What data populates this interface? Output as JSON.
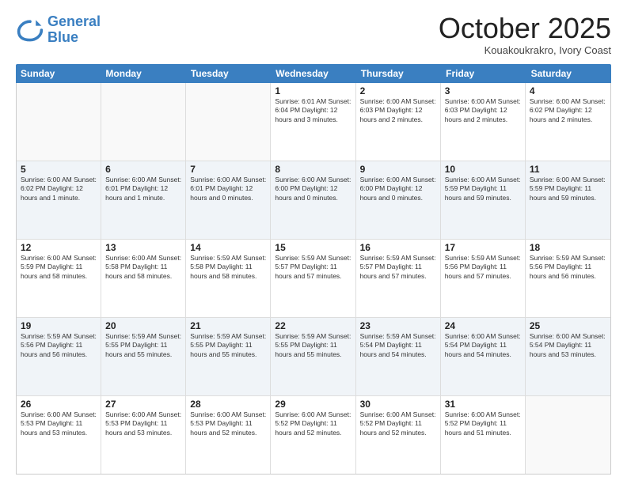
{
  "logo": {
    "line1": "General",
    "line2": "Blue"
  },
  "title": "October 2025",
  "location": "Kouakoukrakro, Ivory Coast",
  "header_days": [
    "Sunday",
    "Monday",
    "Tuesday",
    "Wednesday",
    "Thursday",
    "Friday",
    "Saturday"
  ],
  "weeks": [
    [
      {
        "day": "",
        "info": "",
        "empty": true
      },
      {
        "day": "",
        "info": "",
        "empty": true
      },
      {
        "day": "",
        "info": "",
        "empty": true
      },
      {
        "day": "1",
        "info": "Sunrise: 6:01 AM\nSunset: 6:04 PM\nDaylight: 12 hours\nand 3 minutes.",
        "empty": false
      },
      {
        "day": "2",
        "info": "Sunrise: 6:00 AM\nSunset: 6:03 PM\nDaylight: 12 hours\nand 2 minutes.",
        "empty": false
      },
      {
        "day": "3",
        "info": "Sunrise: 6:00 AM\nSunset: 6:03 PM\nDaylight: 12 hours\nand 2 minutes.",
        "empty": false
      },
      {
        "day": "4",
        "info": "Sunrise: 6:00 AM\nSunset: 6:02 PM\nDaylight: 12 hours\nand 2 minutes.",
        "empty": false
      }
    ],
    [
      {
        "day": "5",
        "info": "Sunrise: 6:00 AM\nSunset: 6:02 PM\nDaylight: 12 hours\nand 1 minute.",
        "empty": false
      },
      {
        "day": "6",
        "info": "Sunrise: 6:00 AM\nSunset: 6:01 PM\nDaylight: 12 hours\nand 1 minute.",
        "empty": false
      },
      {
        "day": "7",
        "info": "Sunrise: 6:00 AM\nSunset: 6:01 PM\nDaylight: 12 hours\nand 0 minutes.",
        "empty": false
      },
      {
        "day": "8",
        "info": "Sunrise: 6:00 AM\nSunset: 6:00 PM\nDaylight: 12 hours\nand 0 minutes.",
        "empty": false
      },
      {
        "day": "9",
        "info": "Sunrise: 6:00 AM\nSunset: 6:00 PM\nDaylight: 12 hours\nand 0 minutes.",
        "empty": false
      },
      {
        "day": "10",
        "info": "Sunrise: 6:00 AM\nSunset: 5:59 PM\nDaylight: 11 hours\nand 59 minutes.",
        "empty": false
      },
      {
        "day": "11",
        "info": "Sunrise: 6:00 AM\nSunset: 5:59 PM\nDaylight: 11 hours\nand 59 minutes.",
        "empty": false
      }
    ],
    [
      {
        "day": "12",
        "info": "Sunrise: 6:00 AM\nSunset: 5:59 PM\nDaylight: 11 hours\nand 58 minutes.",
        "empty": false
      },
      {
        "day": "13",
        "info": "Sunrise: 6:00 AM\nSunset: 5:58 PM\nDaylight: 11 hours\nand 58 minutes.",
        "empty": false
      },
      {
        "day": "14",
        "info": "Sunrise: 5:59 AM\nSunset: 5:58 PM\nDaylight: 11 hours\nand 58 minutes.",
        "empty": false
      },
      {
        "day": "15",
        "info": "Sunrise: 5:59 AM\nSunset: 5:57 PM\nDaylight: 11 hours\nand 57 minutes.",
        "empty": false
      },
      {
        "day": "16",
        "info": "Sunrise: 5:59 AM\nSunset: 5:57 PM\nDaylight: 11 hours\nand 57 minutes.",
        "empty": false
      },
      {
        "day": "17",
        "info": "Sunrise: 5:59 AM\nSunset: 5:56 PM\nDaylight: 11 hours\nand 57 minutes.",
        "empty": false
      },
      {
        "day": "18",
        "info": "Sunrise: 5:59 AM\nSunset: 5:56 PM\nDaylight: 11 hours\nand 56 minutes.",
        "empty": false
      }
    ],
    [
      {
        "day": "19",
        "info": "Sunrise: 5:59 AM\nSunset: 5:56 PM\nDaylight: 11 hours\nand 56 minutes.",
        "empty": false
      },
      {
        "day": "20",
        "info": "Sunrise: 5:59 AM\nSunset: 5:55 PM\nDaylight: 11 hours\nand 55 minutes.",
        "empty": false
      },
      {
        "day": "21",
        "info": "Sunrise: 5:59 AM\nSunset: 5:55 PM\nDaylight: 11 hours\nand 55 minutes.",
        "empty": false
      },
      {
        "day": "22",
        "info": "Sunrise: 5:59 AM\nSunset: 5:55 PM\nDaylight: 11 hours\nand 55 minutes.",
        "empty": false
      },
      {
        "day": "23",
        "info": "Sunrise: 5:59 AM\nSunset: 5:54 PM\nDaylight: 11 hours\nand 54 minutes.",
        "empty": false
      },
      {
        "day": "24",
        "info": "Sunrise: 6:00 AM\nSunset: 5:54 PM\nDaylight: 11 hours\nand 54 minutes.",
        "empty": false
      },
      {
        "day": "25",
        "info": "Sunrise: 6:00 AM\nSunset: 5:54 PM\nDaylight: 11 hours\nand 53 minutes.",
        "empty": false
      }
    ],
    [
      {
        "day": "26",
        "info": "Sunrise: 6:00 AM\nSunset: 5:53 PM\nDaylight: 11 hours\nand 53 minutes.",
        "empty": false
      },
      {
        "day": "27",
        "info": "Sunrise: 6:00 AM\nSunset: 5:53 PM\nDaylight: 11 hours\nand 53 minutes.",
        "empty": false
      },
      {
        "day": "28",
        "info": "Sunrise: 6:00 AM\nSunset: 5:53 PM\nDaylight: 11 hours\nand 52 minutes.",
        "empty": false
      },
      {
        "day": "29",
        "info": "Sunrise: 6:00 AM\nSunset: 5:52 PM\nDaylight: 11 hours\nand 52 minutes.",
        "empty": false
      },
      {
        "day": "30",
        "info": "Sunrise: 6:00 AM\nSunset: 5:52 PM\nDaylight: 11 hours\nand 52 minutes.",
        "empty": false
      },
      {
        "day": "31",
        "info": "Sunrise: 6:00 AM\nSunset: 5:52 PM\nDaylight: 11 hours\nand 51 minutes.",
        "empty": false
      },
      {
        "day": "",
        "info": "",
        "empty": true
      }
    ]
  ]
}
